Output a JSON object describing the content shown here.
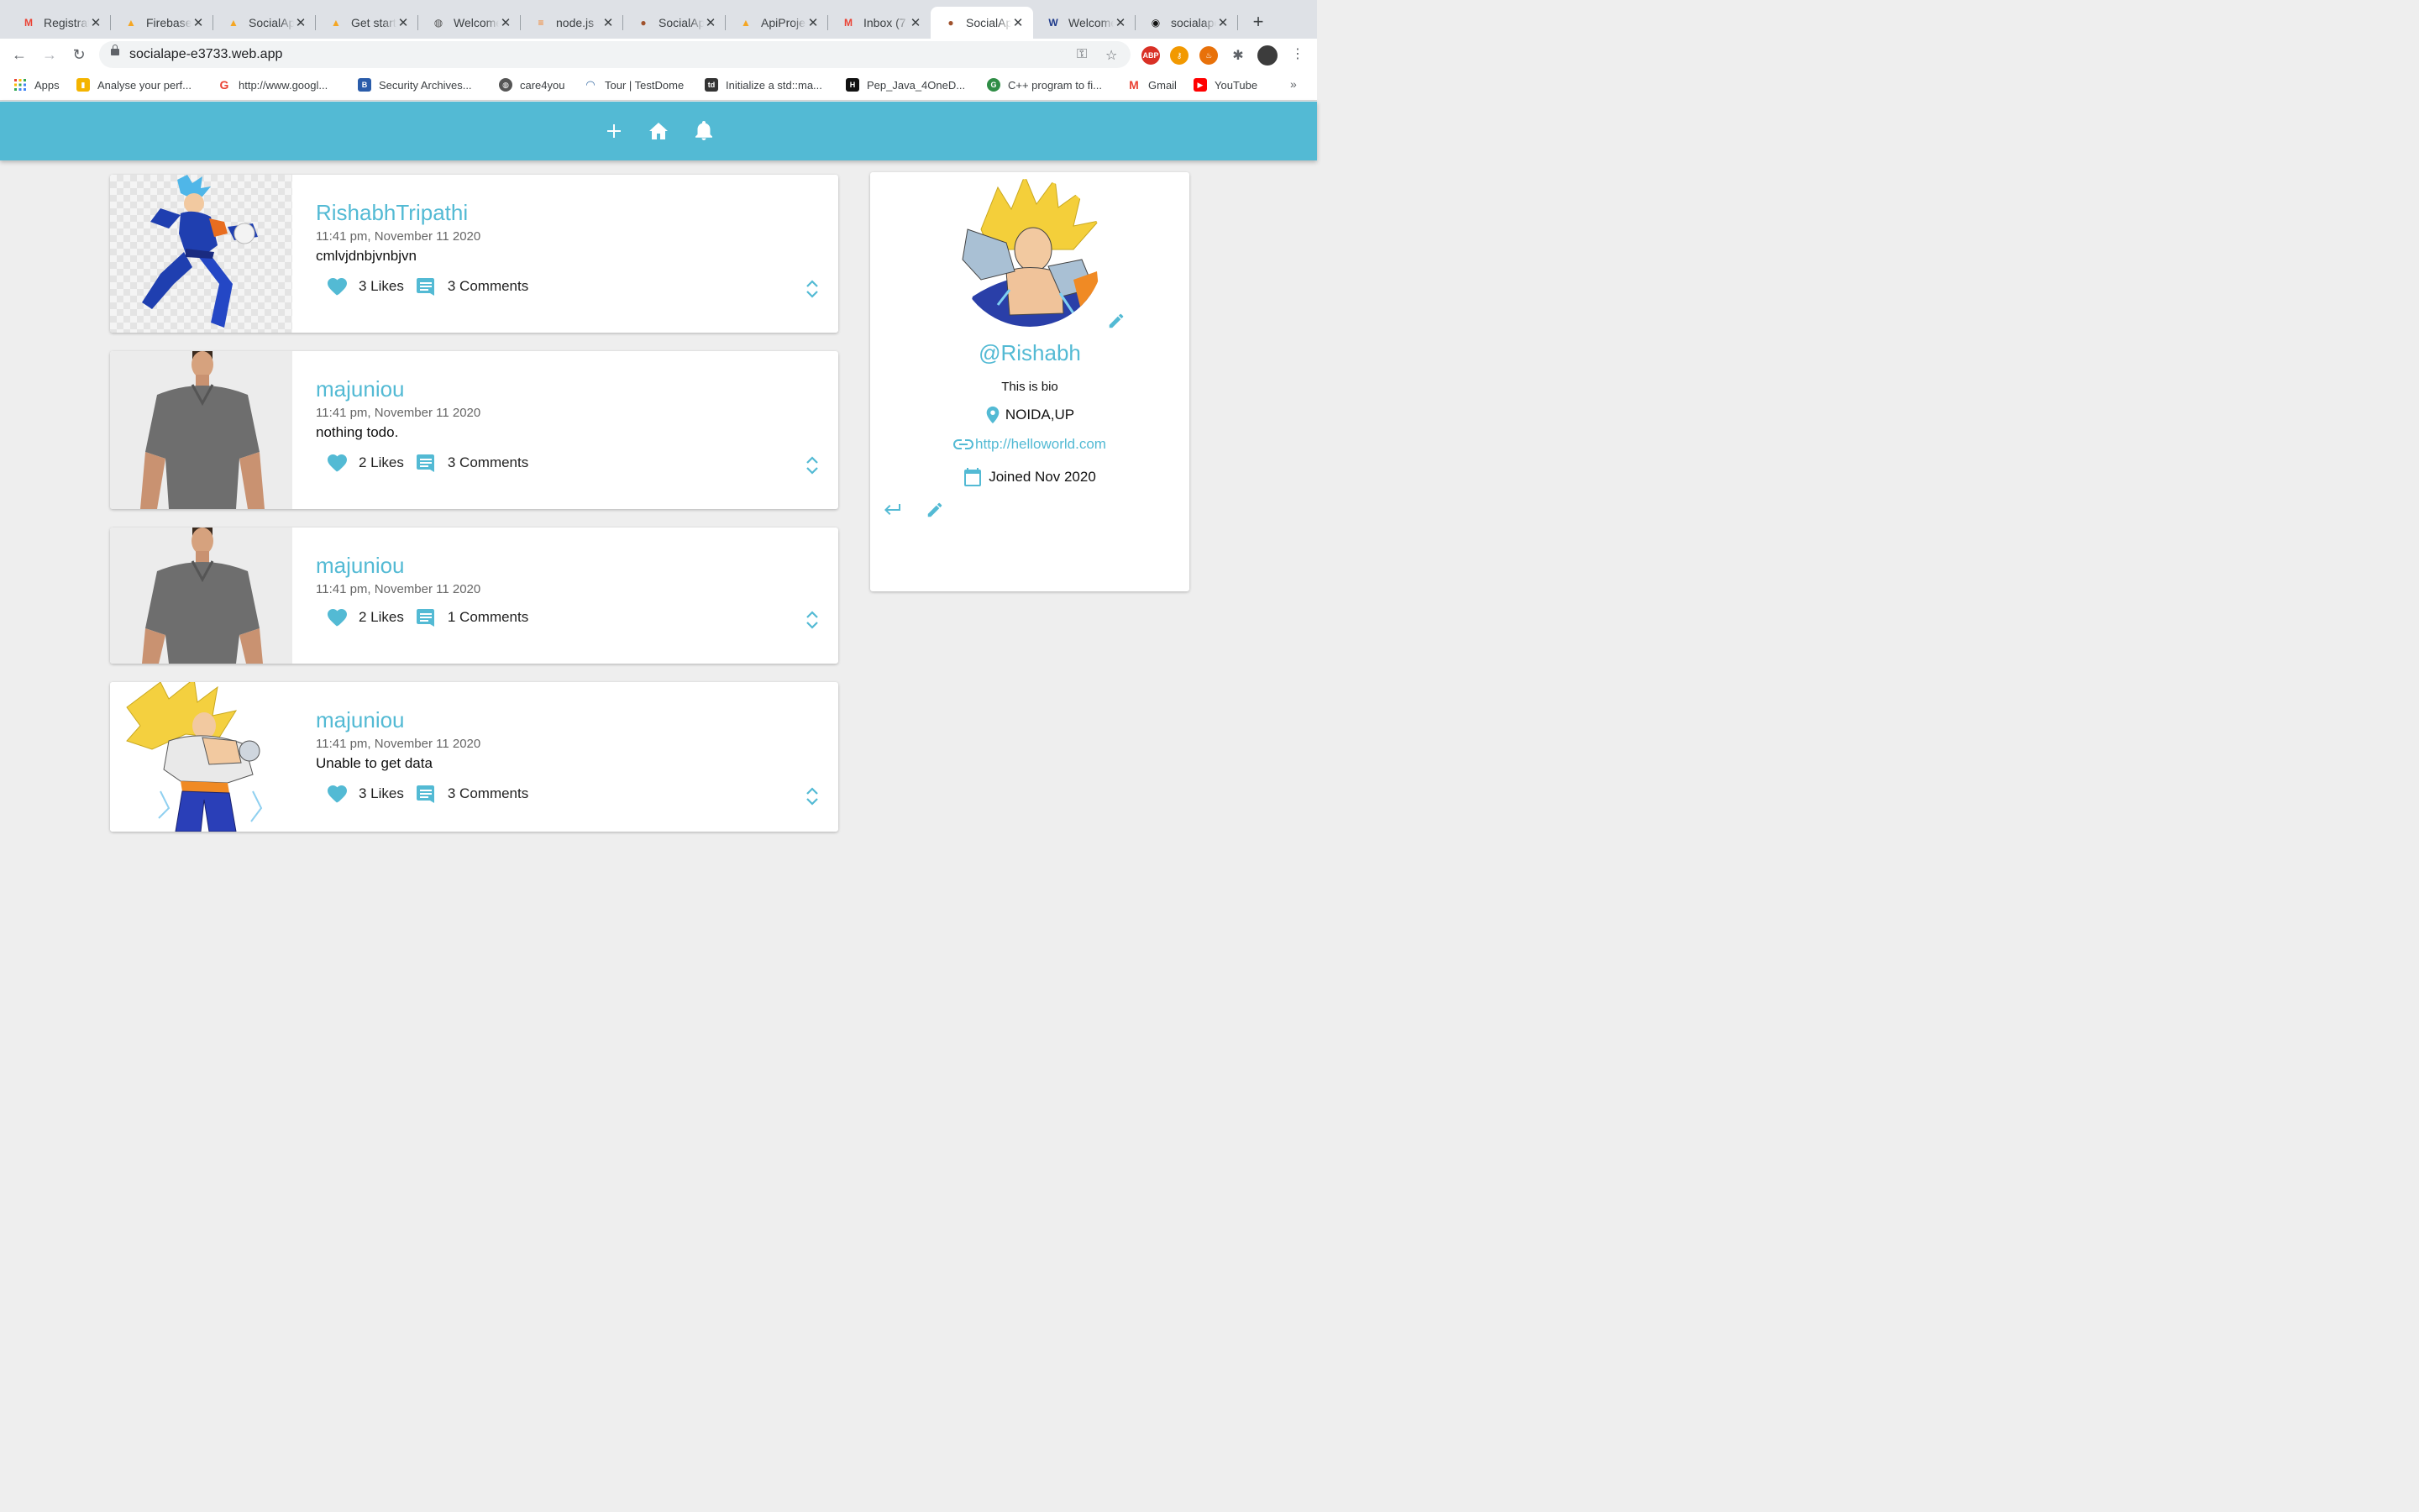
{
  "browser": {
    "tabs": [
      {
        "title": "Registration",
        "icon": "gmail-icon",
        "active": false
      },
      {
        "title": "Firebase",
        "icon": "firebase-icon",
        "active": false
      },
      {
        "title": "SocialApe",
        "icon": "firebase-icon",
        "active": false
      },
      {
        "title": "Get started",
        "icon": "firebase-icon",
        "active": false
      },
      {
        "title": "Welcome",
        "icon": "globe-icon",
        "active": false
      },
      {
        "title": "node.js",
        "icon": "stackoverflow-icon",
        "active": false
      },
      {
        "title": "SocialApe",
        "icon": "monkey-icon",
        "active": false
      },
      {
        "title": "ApiProject",
        "icon": "firebase-icon",
        "active": false
      },
      {
        "title": "Inbox (7",
        "icon": "gmail-icon",
        "active": false
      },
      {
        "title": "SocialApe",
        "icon": "monkey-icon",
        "active": true
      },
      {
        "title": "Welcome",
        "icon": "wordpress-icon",
        "active": false
      },
      {
        "title": "socialape",
        "icon": "github-icon",
        "active": false
      }
    ],
    "url": "socialape-e3733.web.app",
    "bookmarks": [
      {
        "label": "Apps",
        "icon": "apps-grid-icon",
        "color": "#4285f4"
      },
      {
        "label": "Analyse your perf...",
        "icon": "analytics-icon",
        "color": "#f4b400"
      },
      {
        "label": "http://www.googl...",
        "icon": "google-icon",
        "color": "#ea4335"
      },
      {
        "label": "Security Archives...",
        "icon": "blog-icon",
        "color": "#2a5caa"
      },
      {
        "label": "care4you",
        "icon": "globe-icon",
        "color": "#555555"
      },
      {
        "label": "Tour | TestDome",
        "icon": "testdome-icon",
        "color": "#3b6ea5"
      },
      {
        "label": "Initialize a std::ma...",
        "icon": "td-icon",
        "color": "#333333"
      },
      {
        "label": "Pep_Java_4OneD...",
        "icon": "hackerearth-icon",
        "color": "#111111"
      },
      {
        "label": "C++ program to fi...",
        "icon": "geeks-icon",
        "color": "#2f8d46"
      },
      {
        "label": "Gmail",
        "icon": "gmail-icon",
        "color": "#ea4335"
      },
      {
        "label": "YouTube",
        "icon": "youtube-icon",
        "color": "#ff0000"
      }
    ]
  },
  "theme": {
    "accent": "#53bad4",
    "background": "#eeeeee"
  },
  "posts": [
    {
      "handle": "RishabhTripathi",
      "date": "11:41 pm, November 11 2020",
      "body": "cmlvjdnbjvnbjvn",
      "likes": "3 Likes",
      "comments": "3 Comments",
      "image": "vegito-figure"
    },
    {
      "handle": "majuniou",
      "date": "11:41 pm, November 11 2020",
      "body": "nothing todo.",
      "likes": "2 Likes",
      "comments": "3 Comments",
      "image": "man-grey-tshirt"
    },
    {
      "handle": "majuniou",
      "date": "11:41 pm, November 11 2020",
      "body": "",
      "likes": "2 Likes",
      "comments": "1 Comments",
      "image": "man-grey-tshirt"
    },
    {
      "handle": "majuniou",
      "date": "11:41 pm, November 11 2020",
      "body": "Unable to get data",
      "likes": "3 Likes",
      "comments": "3 Comments",
      "image": "super-saiyan-figure"
    }
  ],
  "profile": {
    "handle": "@Rishabh",
    "bio": "This is bio",
    "location": "NOIDA,UP",
    "website": "http://helloworld.com",
    "joined": "Joined Nov 2020"
  }
}
